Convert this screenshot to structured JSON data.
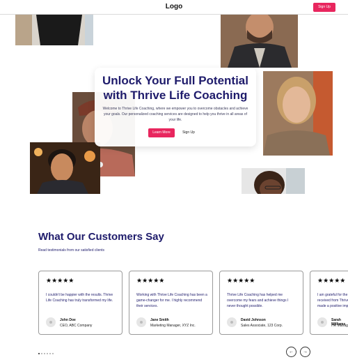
{
  "header": {
    "logo": "Logo",
    "signup_label": "Sign Up"
  },
  "hero": {
    "title": "Unlock Your Full Potential with Thrive Life Coaching",
    "description": "Welcome to Thrive Life Coaching, where we empower you to overcome obstacles and achieve your goals. Our personalized coaching services are designed to help you thrive in all areas of your life.",
    "learn_more_label": "Learn More",
    "signup_label": "Sign Up"
  },
  "testimonials": {
    "title": "What Our Customers Say",
    "subtitle": "Read testimonials from our satisfied clients",
    "items": [
      {
        "stars": "★★★★★",
        "quote": "I couldn't be happier with the results. Thrive Life Coaching has truly transformed my life.",
        "name": "John Doe",
        "role": "CEO, ABC Company"
      },
      {
        "stars": "★★★★★",
        "quote": "Working with Thrive Life Coaching has been a game-changer for me. I highly recommend their services.",
        "name": "Jane Smith",
        "role": "Marketing Manager, XYZ Inc."
      },
      {
        "stars": "★★★★★",
        "quote": "Thrive Life Coaching has helped me overcome my fears and achieve things I never thought possible.",
        "name": "David Johnson",
        "role": "Sales Associate, 123 Corp."
      },
      {
        "stars": "★★★★★",
        "quote": "I am grateful for the guidance and support I received from Thrive Life Coaching. It has made a positive impact on my life.",
        "name": "Sarah Williams",
        "role": "HR Manager"
      }
    ]
  },
  "carousel": {
    "prev_icon": "←",
    "next_icon": "→",
    "dot_count": 6,
    "active_dot": 0
  },
  "colors": {
    "accent": "#e8265e",
    "heading": "#1e1b6b"
  }
}
